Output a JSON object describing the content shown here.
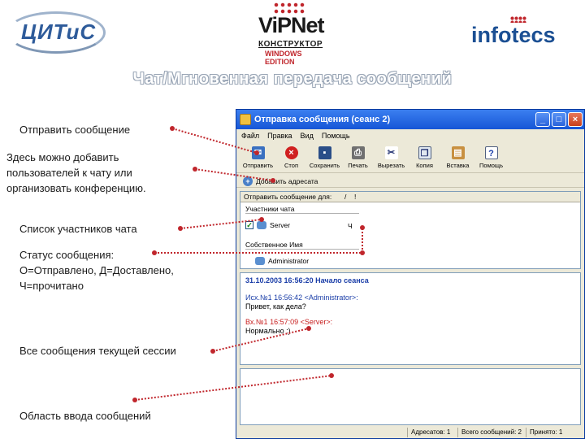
{
  "header": {
    "logo_citis": "ЦИТиС",
    "logo_vipnet": "ViPNet",
    "logo_vipnet_sub1": "КОНСТРУКТОР",
    "logo_vipnet_sub2": "WINDOWS EDITION",
    "logo_infotecs": "infotecs",
    "slide_title": "Чат/Мгновенная передача сообщений"
  },
  "callouts": {
    "send": "Отправить сообщение",
    "add_users": [
      "Здесь можно добавить",
      "пользователей к чату или",
      "организовать конференцию."
    ],
    "participants": "Список участников чата",
    "status": [
      "Статус сообщения:",
      "О=Отправлено, Д=Доставлено,",
      "Ч=прочитано"
    ],
    "messages": "Все сообщения текущей сессии",
    "input": "Область ввода сообщений"
  },
  "window": {
    "title": "Отправка сообщения (сеанс 2)",
    "menu": [
      "Файл",
      "Правка",
      "Вид",
      "Помощь"
    ],
    "toolbar": [
      {
        "label": "Отправить",
        "icon": "send-icon"
      },
      {
        "label": "Стоп",
        "icon": "stop-icon"
      },
      {
        "label": "Сохранить",
        "icon": "save-icon"
      },
      {
        "label": "Печать",
        "icon": "print-icon"
      },
      {
        "label": "Вырезать",
        "icon": "cut-icon"
      },
      {
        "label": "Копия",
        "icon": "copy-icon"
      },
      {
        "label": "Вставка",
        "icon": "paste-icon"
      },
      {
        "label": "Помощь",
        "icon": "help-icon"
      }
    ],
    "add_address": "Добавить адресата",
    "list": {
      "header_col1": "Отправить сообщение для:",
      "header_col2": "/",
      "header_col3": "!",
      "group_participants": "Участники чата",
      "participant": "Server",
      "participant_status": "Ч",
      "group_own": "Собственное Имя",
      "own_name": "Administrator"
    },
    "log": {
      "session": "31.10.2003 16:56:20 Начало сеанса",
      "in_header": "Исх.№1 16:56:42 <Administrator>:",
      "in_text": "Привет, как дела?",
      "out_header": "Вх.№1 16:57:09 <Server>:",
      "out_text": "Нормально :)"
    },
    "status_bar": [
      "Адресатов: 1",
      "Всего сообщений: 2",
      "Принято: 1"
    ]
  },
  "colors": {
    "title_blue": "#1656d6",
    "session_blue": "#1b3ea8",
    "incoming_red": "#c82020",
    "connector_red": "#c0262c"
  }
}
